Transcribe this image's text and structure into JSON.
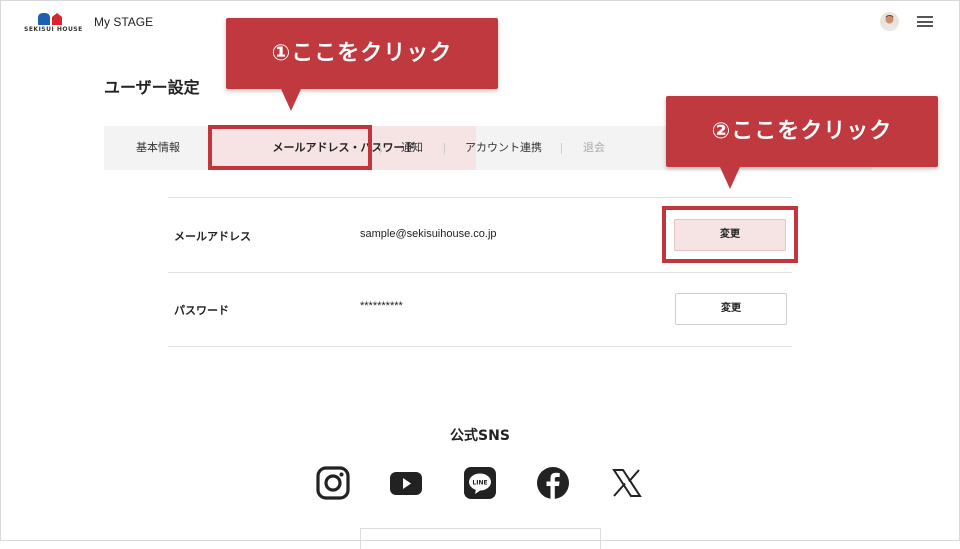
{
  "header": {
    "brand": "SEKISUI HOUSE",
    "app_title": "My STAGE"
  },
  "page": {
    "title": "ユーザー設定"
  },
  "tabs": [
    {
      "label": "基本情報",
      "state": "normal"
    },
    {
      "label": "メールアドレス・パスワード",
      "state": "active"
    },
    {
      "label": "通知",
      "state": "normal"
    },
    {
      "label": "アカウント連携",
      "state": "normal"
    },
    {
      "label": "退会",
      "state": "disabled"
    }
  ],
  "rows": [
    {
      "label": "メールアドレス",
      "value": "sample@sekisuihouse.co.jp",
      "button": "変更"
    },
    {
      "label": "パスワード",
      "value": "**********",
      "button": "変更"
    }
  ],
  "callouts": {
    "first": "①ここをクリック",
    "second": "②ここをクリック"
  },
  "sns": {
    "title": "公式SNS",
    "icons": [
      "instagram-icon",
      "youtube-icon",
      "line-icon",
      "facebook-icon",
      "x-icon"
    ]
  },
  "colors": {
    "accent_red": "#c0393f",
    "active_tab_bg": "#f6e3e4",
    "tabbar_bg": "#f3f3f3"
  }
}
